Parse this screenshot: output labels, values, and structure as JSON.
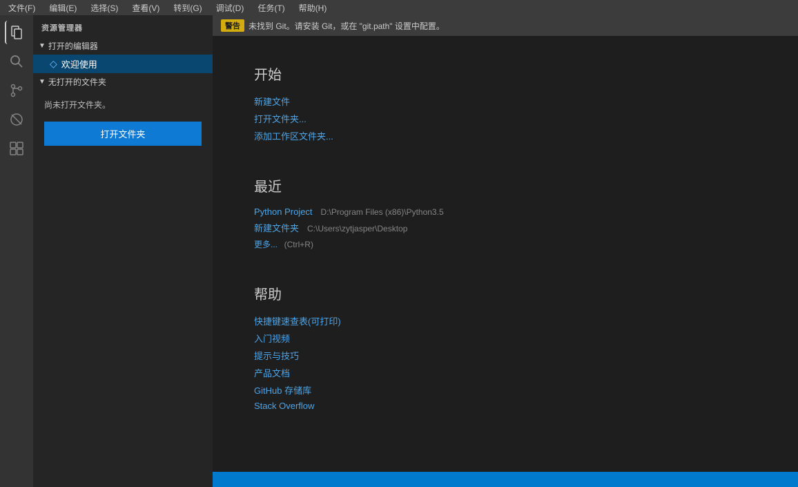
{
  "titlebar": {
    "menus": [
      "文件(F)",
      "编辑(E)",
      "选择(S)",
      "查看(V)",
      "转到(G)",
      "调试(D)",
      "任务(T)",
      "帮助(H)"
    ]
  },
  "sidebar": {
    "header": "资源管理器",
    "open_editors_section": "打开的编辑器",
    "welcome_tab": "欢迎使用",
    "no_folder_section": "无打开的文件夹",
    "no_folder_msg": "尚未打开文件夹。",
    "open_folder_btn": "打开文件夹"
  },
  "warning": {
    "label": "警告",
    "message": "未找到 Git。请安装 Git，或在 \"git.path\" 设置中配置。"
  },
  "welcome": {
    "start_section": {
      "title": "开始",
      "links": [
        {
          "label": "新建文件",
          "id": "new-file"
        },
        {
          "label": "打开文件夹...",
          "id": "open-folder"
        },
        {
          "label": "添加工作区文件夹...",
          "id": "add-workspace-folder"
        }
      ]
    },
    "recent_section": {
      "title": "最近",
      "items": [
        {
          "name": "Python Project",
          "path": "D:\\Program Files (x86)\\Python3.5"
        },
        {
          "name": "新建文件夹",
          "path": "C:\\Users\\zytjasper\\Desktop"
        }
      ],
      "more_label": "更多...",
      "more_shortcut": "(Ctrl+R)"
    },
    "help_section": {
      "title": "帮助",
      "links": [
        {
          "label": "快捷键速查表(可打印)",
          "id": "keybindings"
        },
        {
          "label": "入门视频",
          "id": "intro-videos"
        },
        {
          "label": "提示与技巧",
          "id": "tips-tricks"
        },
        {
          "label": "产品文档",
          "id": "docs"
        },
        {
          "label": "GitHub 存储库",
          "id": "github"
        },
        {
          "label": "Stack Overflow",
          "id": "stackoverflow"
        }
      ]
    }
  },
  "activity_icons": [
    {
      "id": "explorer",
      "symbol": "⬜",
      "active": true
    },
    {
      "id": "search",
      "symbol": "🔍"
    },
    {
      "id": "git",
      "symbol": "⑂"
    },
    {
      "id": "debug",
      "symbol": "🚫"
    },
    {
      "id": "extensions",
      "symbol": "⊞"
    }
  ]
}
